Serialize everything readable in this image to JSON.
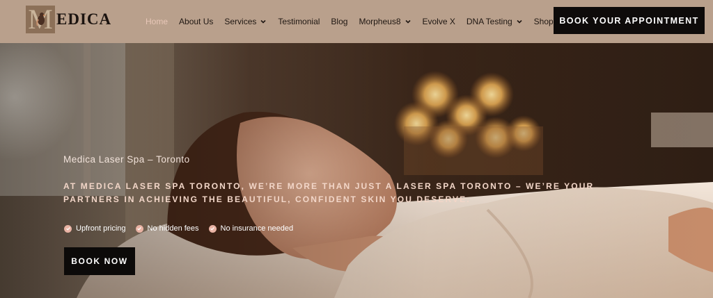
{
  "header": {
    "logo_text": "EDICA",
    "logo_mark": "M",
    "nav": [
      {
        "label": "Home",
        "active": true,
        "dropdown": false
      },
      {
        "label": "About Us",
        "active": false,
        "dropdown": false
      },
      {
        "label": "Services",
        "active": false,
        "dropdown": true
      },
      {
        "label": "Testimonial",
        "active": false,
        "dropdown": false
      },
      {
        "label": "Blog",
        "active": false,
        "dropdown": false
      },
      {
        "label": "Morpheus8",
        "active": false,
        "dropdown": true
      },
      {
        "label": "Evolve X",
        "active": false,
        "dropdown": false
      },
      {
        "label": "DNA Testing",
        "active": false,
        "dropdown": true
      },
      {
        "label": "Shop",
        "active": false,
        "dropdown": true
      }
    ],
    "cta_label": "BOOK YOUR APPOINTMENT"
  },
  "hero": {
    "eyebrow": "Medica  Laser Spa  –  Toronto",
    "headline": "AT MEDICA LASER SPA TORONTO, WE’RE MORE THAN JUST A LASER SPA TORONTO – WE’RE YOUR PARTNERS IN ACHIEVING THE BEAUTIFUL, CONFIDENT SKIN YOU DESERVE.",
    "features": [
      "Upfront pricing",
      "No hidden fees",
      "No insurance needed"
    ],
    "button_label": "BOOK NOW"
  },
  "colors": {
    "header_bg": "#b9a08c",
    "active_nav": "#e8c7b8",
    "cta_bg": "#0e0b0a",
    "check": "#e9b3a4"
  },
  "icons": {
    "check": "check-circle-icon",
    "dropdown": "chevron-down-icon"
  }
}
